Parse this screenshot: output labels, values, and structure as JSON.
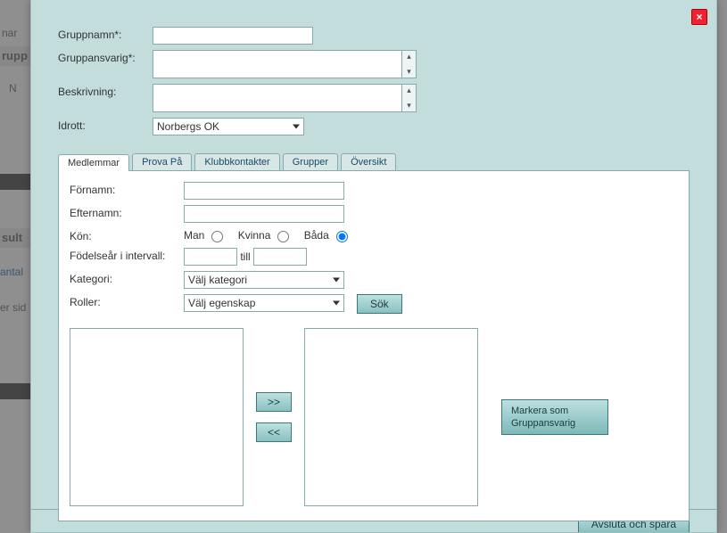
{
  "background": {
    "frag_nar": "nar",
    "frag_rupp": "rupp",
    "frag_n": "N",
    "frag_sult": "sult",
    "frag_antal": "antal",
    "frag_ersid": "er sid"
  },
  "modal": {
    "close_glyph": "×",
    "top_form": {
      "gruppnamn_label": "Gruppnamn*:",
      "gruppnamn_value": "",
      "gruppansvarig_label": "Gruppansvarig*:",
      "gruppansvarig_value": "",
      "beskrivning_label": "Beskrivning:",
      "beskrivning_value": "",
      "idrott_label": "Idrott:",
      "idrott_selected": "Norbergs OK"
    },
    "tabs": {
      "medlemmar": "Medlemmar",
      "prova": "Prova På",
      "klubb": "Klubbkontakter",
      "grupper": "Grupper",
      "oversikt": "Översikt"
    },
    "medlemmar_panel": {
      "fornamn_label": "Förnamn:",
      "fornamn_value": "",
      "efternamn_label": "Efternamn:",
      "efternamn_value": "",
      "kon_label": "Kön:",
      "kon_man": "Man",
      "kon_kvinna": "Kvinna",
      "kon_bada": "Båda",
      "fodelsear_label": "Födelseår i intervall:",
      "fodelsear_from": "",
      "till_text": "till",
      "fodelsear_to": "",
      "kategori_label": "Kategori:",
      "kategori_selected": "Välj kategori",
      "roller_label": "Roller:",
      "roller_selected": "Välj egenskap",
      "sok_label": "Sök",
      "move_right": ">>",
      "move_left": "<<",
      "mark_btn_line1": "Markera som",
      "mark_btn_line2": "Gruppansvarig"
    },
    "footer": {
      "save_label": "Avsluta och spara"
    }
  }
}
